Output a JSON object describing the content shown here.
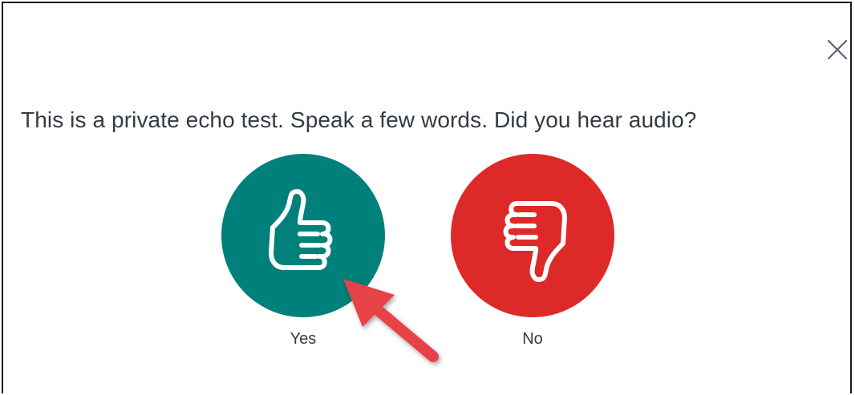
{
  "dialog": {
    "close_icon": "close-icon",
    "prompt": "This is a private echo test. Speak a few words. Did you hear audio?",
    "choices": [
      {
        "label": "Yes",
        "icon": "thumbs-up-icon",
        "color": "#00807a"
      },
      {
        "label": "No",
        "icon": "thumbs-down-icon",
        "color": "#dd2a28"
      }
    ]
  },
  "annotation": {
    "icon": "arrow-icon",
    "color": "#e8434a"
  }
}
